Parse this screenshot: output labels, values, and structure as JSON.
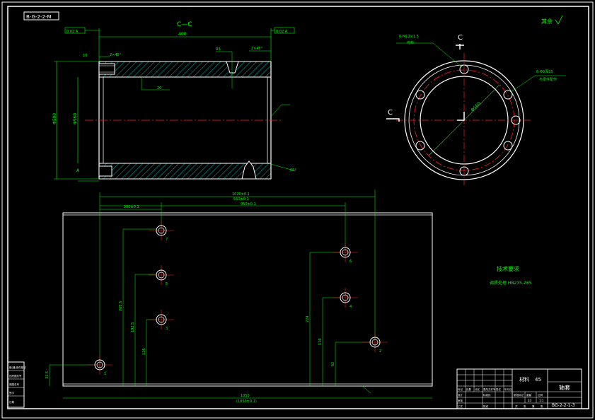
{
  "colors": {
    "background": "#000000",
    "outline": "#ffffff",
    "dimension": "#00ff00",
    "centerline": "#ff0000",
    "hatch": "#00ffff",
    "note": "#ffff00"
  },
  "drawing_code_box": "B-G-2-2-M",
  "section_title": "C—C",
  "section_mark_top": "C",
  "section_mark_left": "C",
  "roughness_label": "其余",
  "tech_title": "技术要求",
  "tech_note": "调质处理 HB235-265",
  "title_block": {
    "material_label": "材料",
    "material_value": "45",
    "part_name": "轴套",
    "drawing_number": "BG-2-2-1-3",
    "scale": "1:1",
    "quantity": "1",
    "weight": "24",
    "row_labels": [
      "标记",
      "处数",
      "分区",
      "更改文件号",
      "签名",
      "年月日"
    ],
    "row2_labels": [
      "设计",
      "标准化"
    ],
    "row3_labels": [
      "审核",
      "工艺",
      "批准"
    ],
    "small_labels": [
      "阶段标记",
      "重量",
      "比例"
    ],
    "sheet_labels": [
      "共",
      "张",
      "第",
      "张"
    ]
  },
  "side_stamp": [
    "借(通)用件登记",
    "旧底图总号",
    "底图总号",
    "签字",
    "日期"
  ],
  "dimensions": {
    "length_top": "400±0",
    "length_overall": "400",
    "dia_outer": "Φ590",
    "dia_inner": "Φ560",
    "chamfer_1": "2×45°",
    "chamfer_2": "2×45°",
    "bore_depth": "20",
    "groove": "R3",
    "hole_pcd": "Φ560",
    "hole_spec": "6-M12×1.5",
    "hole_note": "均布",
    "hole_spec2": "6-Φ9深25",
    "hole_note2": "与零件配作",
    "ref_a": "A",
    "tol_left": "0.02 A",
    "tol_right": "0.02 A",
    "angle": "60°",
    "thread_depth": "10"
  },
  "layout_dims": {
    "x_total": "1020±0.1",
    "x_a": "960±0.1",
    "x_b": "260±0.1",
    "x_c": "560±0.1",
    "y_1": "265.5",
    "y_2": "192.5",
    "y_3": "125",
    "y_4": "224",
    "y_5": "119",
    "y_6": "62",
    "y_7": "32.5",
    "width": "1050",
    "width_tol": "(1050±0.1)"
  },
  "hole_labels": [
    "1",
    "2",
    "3",
    "4",
    "5",
    "6",
    "7"
  ]
}
